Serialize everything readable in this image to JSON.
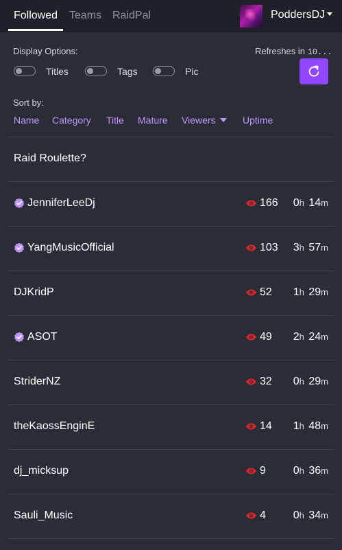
{
  "header": {
    "tabs": [
      {
        "label": "Followed",
        "active": true
      },
      {
        "label": "Teams",
        "active": false
      },
      {
        "label": "RaidPal",
        "active": false
      }
    ],
    "username": "PoddersDJ"
  },
  "options": {
    "display_label": "Display Options:",
    "refresh_prefix": "Refreshes in",
    "refresh_value": "10...",
    "toggles": [
      {
        "label": "Titles",
        "on": false
      },
      {
        "label": "Tags",
        "on": false
      },
      {
        "label": "Pic",
        "on": false
      }
    ]
  },
  "sort": {
    "label": "Sort by:",
    "columns": [
      "Name",
      "Category",
      "Title",
      "Mature",
      "Viewers",
      "Uptime"
    ],
    "active": "Viewers"
  },
  "raid_roulette": "Raid Roulette?",
  "streams": [
    {
      "name": "JenniferLeeDj",
      "verified": true,
      "viewers": "166",
      "hours": "0",
      "minutes": "14"
    },
    {
      "name": "YangMusicOfficial",
      "verified": true,
      "viewers": "103",
      "hours": "3",
      "minutes": "57"
    },
    {
      "name": "DJKridP",
      "verified": false,
      "viewers": "52",
      "hours": "1",
      "minutes": "29"
    },
    {
      "name": "ASOT",
      "verified": true,
      "viewers": "49",
      "hours": "2",
      "minutes": "24"
    },
    {
      "name": "StriderNZ",
      "verified": false,
      "viewers": "32",
      "hours": "0",
      "minutes": "29"
    },
    {
      "name": "theKaossEnginE",
      "verified": false,
      "viewers": "14",
      "hours": "1",
      "minutes": "48"
    },
    {
      "name": "dj_micksup",
      "verified": false,
      "viewers": "9",
      "hours": "0",
      "minutes": "36"
    },
    {
      "name": "Sauli_Music",
      "verified": false,
      "viewers": "4",
      "hours": "0",
      "minutes": "34"
    }
  ],
  "units": {
    "hours": "h",
    "minutes": "m"
  },
  "colors": {
    "background": "#2a2d36",
    "header_background": "#1f2128",
    "accent": "#9147ff",
    "link": "#bf94ff",
    "viewer_icon": "#e0242b",
    "verified_badge": "#bf94ff"
  },
  "icons": {
    "refresh": "refresh-icon",
    "verified": "verified-badge-icon",
    "viewers": "eye-icon"
  }
}
